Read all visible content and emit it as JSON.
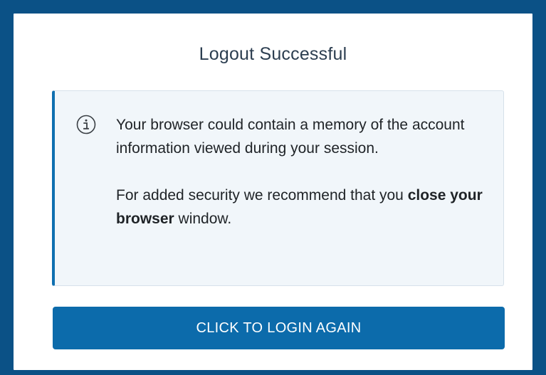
{
  "page": {
    "title": "Logout Successful"
  },
  "notice": {
    "icon": "info-icon",
    "paragraph1": "Your browser could contain a memory of the account information viewed during your session.",
    "paragraph2_prefix": "For added security we recommend that you ",
    "paragraph2_bold": "close your browser",
    "paragraph2_suffix": " window."
  },
  "actions": {
    "login_label": "CLICK TO LOGIN AGAIN"
  },
  "colors": {
    "background": "#0b5186",
    "accent": "#0c6bab",
    "notice_background": "#f1f6fa",
    "notice_border": "#0f6fb0"
  }
}
